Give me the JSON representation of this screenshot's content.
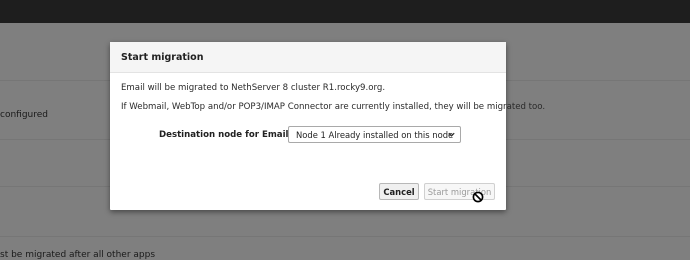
{
  "background": {
    "row_texts": [
      "configured",
      "st be migrated after all other apps"
    ]
  },
  "modal": {
    "title": "Start migration",
    "message_line1": "Email will be migrated to NethServer 8 cluster R1.rocky9.org.",
    "message_line2": "If Webmail, WebTop and/or POP3/IMAP Connector are currently installed, they will be migrated too.",
    "destination_label": "Destination node for Email",
    "destination_selected": "Node 1 Already installed on this node",
    "cancel_label": "Cancel",
    "start_label": "Start migration"
  },
  "cursor": "not-allowed-icon",
  "colors": {
    "topbar": "#1e1e1e",
    "overlay": "#7f7f7f",
    "modal_bg": "#ffffff"
  }
}
